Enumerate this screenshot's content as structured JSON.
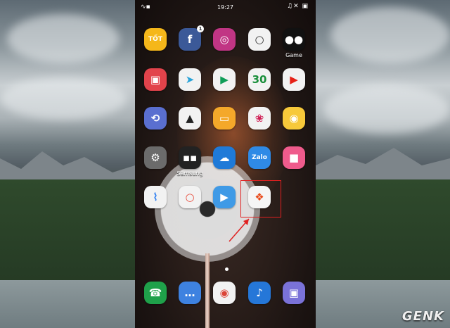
{
  "status_bar": {
    "time": "19:27",
    "left_icons": "∿▪",
    "right_icons": "♫✕ ▣"
  },
  "apps": [
    {
      "name": "tot-app",
      "text": "TỐT",
      "bg": "#f5b71a"
    },
    {
      "name": "facebook",
      "text": "f",
      "bg": "#3b5998",
      "badge": "1"
    },
    {
      "name": "instagram",
      "text": "◎",
      "bg": "#c13584"
    },
    {
      "name": "vsco",
      "text": "○",
      "bg": "#f2f2f2",
      "fg": "#333"
    },
    {
      "name": "game-folder",
      "text": "●●",
      "bg": "#111",
      "label": "Game"
    },
    {
      "name": "screen-recorder",
      "text": "▣",
      "bg": "#e2434b"
    },
    {
      "name": "telegram",
      "text": "➤",
      "bg": "#f2f2f2",
      "fg": "#2aa3d8"
    },
    {
      "name": "play-store",
      "text": "▶",
      "bg": "#f2f2f2",
      "fg": "#0f9d58"
    },
    {
      "name": "calendar",
      "text": "30",
      "bg": "#f2f2f2",
      "fg": "#1a8f3b"
    },
    {
      "name": "youtube",
      "text": "▶",
      "bg": "#f2f2f2",
      "fg": "#e62117"
    },
    {
      "name": "share-app",
      "text": "⟲",
      "bg": "#5a6fd0"
    },
    {
      "name": "vectornator",
      "text": "▲",
      "bg": "#f2f2f2",
      "fg": "#222"
    },
    {
      "name": "my-files",
      "text": "▭",
      "bg": "#f4a82a"
    },
    {
      "name": "flower-app",
      "text": "❀",
      "bg": "#f2f2f2",
      "fg": "#d01f55"
    },
    {
      "name": "camera-app",
      "text": "◉",
      "bg": "#f7c93a"
    },
    {
      "name": "settings",
      "text": "⚙",
      "bg": "#6b6b6b"
    },
    {
      "name": "samsung-folder",
      "text": "▪▪",
      "bg": "#222",
      "label": "Samsung"
    },
    {
      "name": "onedrive",
      "text": "☁",
      "bg": "#1f7ad8"
    },
    {
      "name": "zalo",
      "text": "Zalo",
      "bg": "#2f8ae6"
    },
    {
      "name": "save-app",
      "text": "■",
      "bg": "#ef5b8c"
    },
    {
      "name": "messenger",
      "text": "⌇",
      "bg": "#f2f2f2",
      "fg": "#2a7cf0"
    },
    {
      "name": "circle-app",
      "text": "○",
      "bg": "#f2f2f2",
      "fg": "#e74c3c"
    },
    {
      "name": "smart-switch",
      "text": "▶",
      "bg": "#3f9ae6"
    },
    {
      "name": "windows-app",
      "text": "❖",
      "bg": "#f5f5f5",
      "fg": "#e84b1c"
    },
    {
      "name": "empty",
      "text": "",
      "bg": "transparent"
    },
    {
      "name": "phone",
      "text": "☎",
      "bg": "#1fa14a"
    },
    {
      "name": "messages",
      "text": "…",
      "bg": "#3e82e0"
    },
    {
      "name": "chrome",
      "text": "◉",
      "bg": "#f2f2f2",
      "fg": "#db4437"
    },
    {
      "name": "music",
      "text": "♪",
      "bg": "#2577d8"
    },
    {
      "name": "camera",
      "text": "▣",
      "bg": "#7a72d8"
    }
  ],
  "watermark": "GENK",
  "colors": {
    "highlight": "#e02020"
  }
}
